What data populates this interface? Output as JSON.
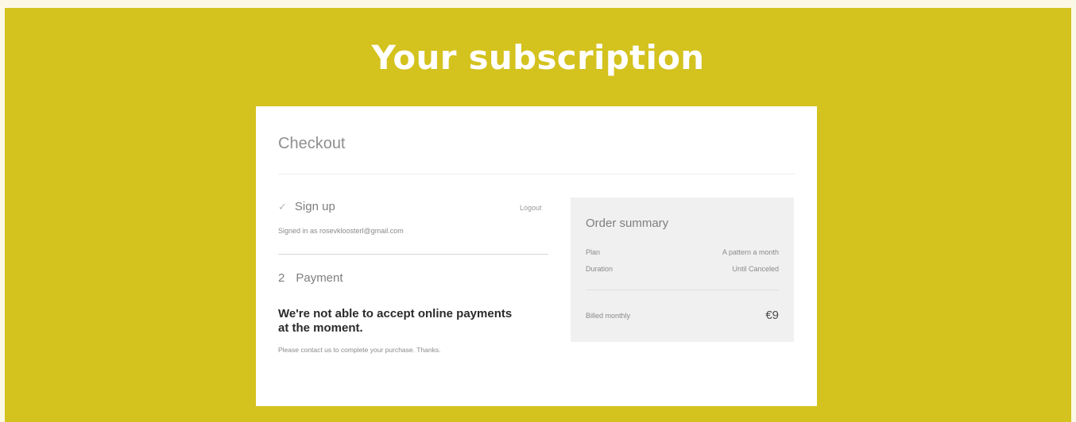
{
  "page": {
    "title": "Your subscription"
  },
  "checkout": {
    "title": "Checkout",
    "signup": {
      "icon": "check-icon",
      "label": "Sign up",
      "logout_label": "Logout",
      "signed_in_text": "Signed in as rosevkloosterl@gmail.com"
    },
    "payment": {
      "step_number": "2",
      "label": "Payment",
      "notice": "We're not able to accept online payments at the moment.",
      "subtext": "Please contact us to complete your purchase. Thanks."
    }
  },
  "order_summary": {
    "title": "Order summary",
    "plan_label": "Plan",
    "plan_value": "A pattern a month",
    "duration_label": "Duration",
    "duration_value": "Until Canceled",
    "billed_label": "Billed monthly",
    "price": "€9"
  },
  "colors": {
    "background": "#d4c21e",
    "card": "#ffffff",
    "summary_panel": "#f0f0f0"
  }
}
